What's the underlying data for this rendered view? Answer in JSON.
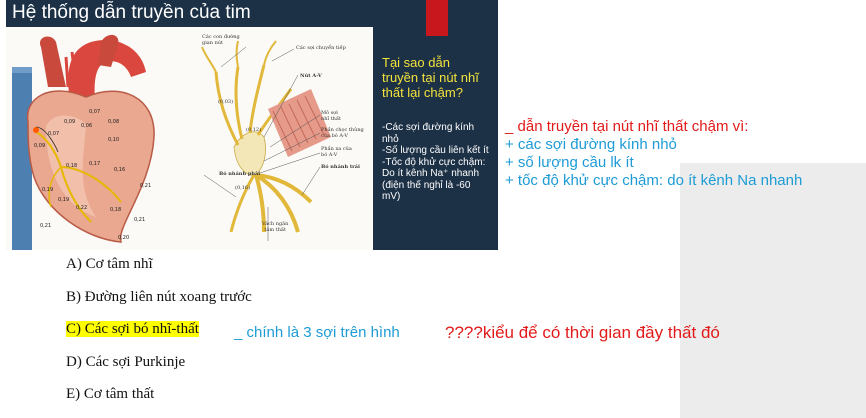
{
  "slide": {
    "title": "Hệ thống dẫn truyền của tim",
    "question_lines": [
      "Tại sao dẫn",
      "truyền tại nút nhĩ",
      "thất lại chậm?"
    ],
    "answer_lines": [
      "-Các sợi đường kính",
      "nhỏ",
      "-Số lượng cầu liên kết ít",
      "-Tốc độ khử cực chậm:",
      "Do ít kênh Na⁺ nhanh",
      "(điện thế nghỉ là -60",
      "mV)"
    ],
    "diagram_labels": {
      "con_duong_gian_nut": "Các con đường\ngian nút",
      "soi_chuyen_tiep": "Các sợi chuyển tiếp",
      "nut_av": "Nút A-V",
      "mo_soi_nhi_that": "Mô sợi\nnhĩ thất",
      "phan_xuyen_thung": "Phần chọc thủng\ncủa bó A-V",
      "phan_xa": "Phần xa của\nbó A-V",
      "bo_nhanh_trai": "Bó nhánh trái",
      "bo_nhanh_phai": "Bó nhánh phải",
      "vach_ngan": "Vách ngăn\ntâm thất"
    },
    "diagram_values": [
      "(0,03)",
      "(0,12)",
      "(0,16)"
    ],
    "heart_numbers": [
      "0,07",
      "0,09",
      "0,06",
      "0,08",
      "0,07",
      "0,10",
      "0,09",
      "0,18",
      "0,17",
      "0,16",
      "0,19",
      "0,21",
      "0,19",
      "0,22",
      "0,18",
      "0,21",
      "0,20",
      "0,21"
    ]
  },
  "options": {
    "a": "A) Cơ tâm nhĩ",
    "b": "B) Đường liên nút xoang trước",
    "c": "C) Các sợi bó nhĩ-thất",
    "d": "D) Các sợi Purkinje",
    "e": "E) Cơ tâm thất"
  },
  "annotations": {
    "red_heading": "_ dẫn truyền tại nút nhĩ thất chậm vì:",
    "blue_points": [
      "+ các sợi đường kính nhỏ",
      "+ số lượng cầu lk ít",
      "+ tốc độ khử cực chậm: do ít kênh Na nhanh"
    ],
    "option_c_note": "_ chính là 3 sợi trên hình",
    "question_note": "????kiểu để có thời gian đầy thất đó"
  },
  "colors": {
    "slide_bg": "#1c3046",
    "question_yellow": "#f3e33b",
    "accent_red": "#c8171d",
    "annotation_red": "#e21a1a",
    "annotation_blue": "#1d9bd6",
    "highlight": "#ffff00"
  }
}
